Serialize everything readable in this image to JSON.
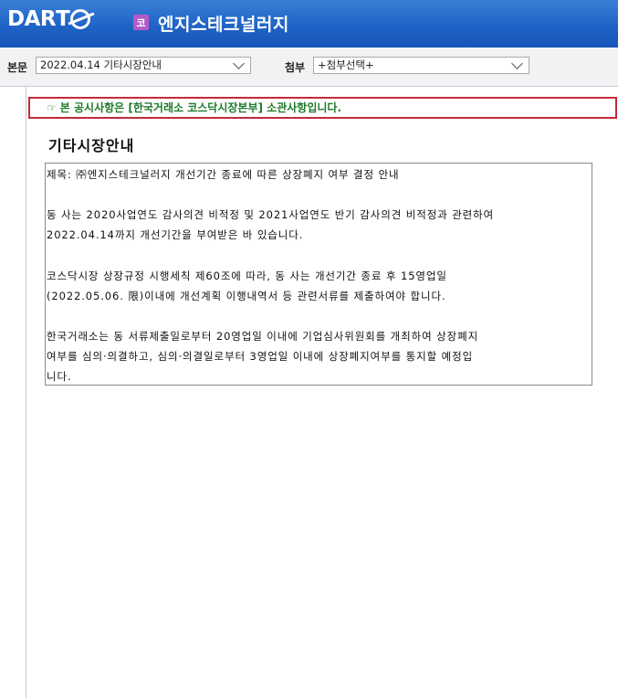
{
  "header": {
    "logo_text": "DART",
    "company_badge": "코",
    "company_name": "엔지스테크널러지"
  },
  "toolbar": {
    "body_label": "본문",
    "body_select_value": "2022.04.14  기타시장안내",
    "attach_label": "첨부",
    "attach_select_value": "+첨부선택+"
  },
  "notice": {
    "icon": "pointing-hand-icon",
    "text": "본 공시사항은 [한국거래소 코스닥시장본부] 소관사항입니다."
  },
  "document": {
    "title": "기타시장안내",
    "subject": "제목: ㈜엔지스테크널러지 개선기간 종료에 따른 상장폐지 여부 결정 안내",
    "para1_line1": "동 사는 2020사업연도 감사의견 비적정 및 2021사업연도 반기 감사의견 비적정과 관련하여",
    "para1_line2": "2022.04.14까지 개선기간을 부여받은 바 있습니다.",
    "para2_line1": "코스닥시장 상장규정 시행세칙 제60조에 따라, 동 사는 개선기간 종료 후 15영업일",
    "para2_line2": "(2022.05.06. 限)이내에 개선계획 이행내역서 등 관련서류를 제출하여야 합니다.",
    "para3_line1": "한국거래소는 동 서류제출일로부터 20영업일 이내에 기업심사위원회를 개최하여 상장폐지",
    "para3_line2": "여부를 심의·의결하고, 심의·의결일로부터 3영업일 이내에 상장폐지여부를 통지할 예정입",
    "para3_line3": "니다."
  },
  "colors": {
    "header_blue": "#1f63c6",
    "notice_border": "#c42a3a",
    "notice_text": "#1e7a2a",
    "badge_purple": "#b45ac8"
  }
}
